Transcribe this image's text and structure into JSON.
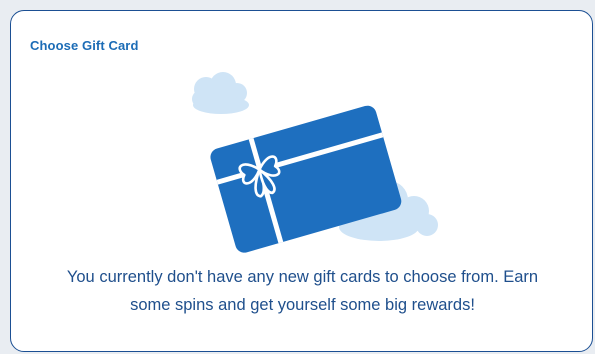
{
  "panel": {
    "title": "Choose Gift Card"
  },
  "empty_state": {
    "message_line1": "You currently don't have any new gift cards to choose from. Earn",
    "message_line2": "some spins and get yourself some big rewards!",
    "illustration_icons": [
      "cloud-icon",
      "gift-card-icon",
      "cloud-icon"
    ]
  },
  "colors": {
    "title": "#1c6cb6",
    "message": "#1f4f8c",
    "border": "#1b4f93",
    "card_fill": "#1e6fbf",
    "cloud": "#cfe4f6",
    "background": "#e9edf2"
  }
}
